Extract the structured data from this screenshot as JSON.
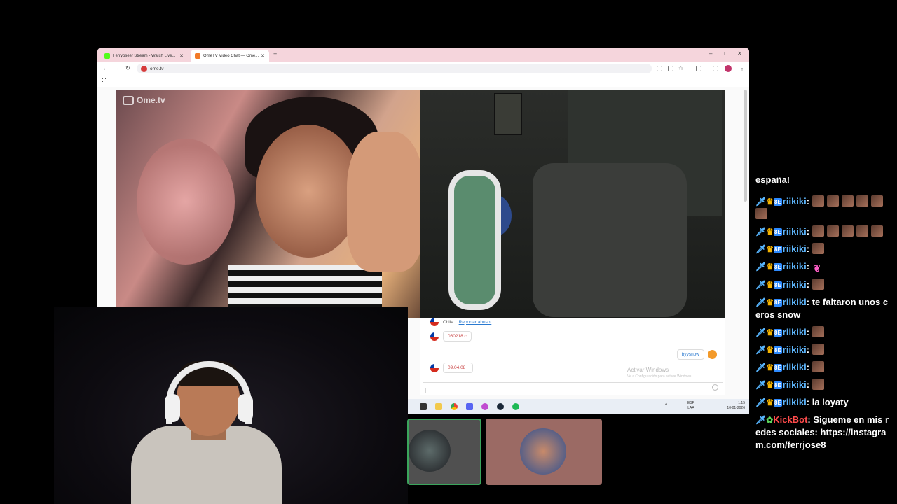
{
  "browser": {
    "tabs": [
      {
        "label": "Ferryoseef Stream - Watch Live...",
        "favicon_color": "#53fc18"
      },
      {
        "label": "OmeTV Video Chat — Ome...",
        "favicon_color": "#f27a28"
      }
    ],
    "new_tab": "+",
    "url": "ome.tv"
  },
  "ometv": {
    "logo": "Ome.tv",
    "chat": {
      "lines": [
        {
          "country": "Chile.",
          "report_label": "Reportar abuso."
        },
        {
          "text": "060218.c"
        },
        {
          "text": "09.04.08_"
        }
      ],
      "own_message": "byysnow",
      "watermark_title": "Activar Windows",
      "watermark_sub": "Ve a Configuración para activar Windows.",
      "input_value": "|"
    }
  },
  "taskbar": {
    "lang": "ESP",
    "lang_sub": "LAA",
    "time": "1:15",
    "date": "10-01-2026"
  },
  "stream_chat": {
    "partial_top": "españa!",
    "messages": [
      {
        "user": "riikiki",
        "text": "",
        "emotes": 6,
        "type": "sub"
      },
      {
        "user": "riikiki",
        "text": "",
        "emotes": 5,
        "type": "sub"
      },
      {
        "user": "riikiki",
        "text": "",
        "emotes": 1,
        "type": "sub"
      },
      {
        "user": "riikiki",
        "text": "",
        "emotes": 1,
        "type": "sub",
        "pink": true
      },
      {
        "user": "riikiki",
        "text": "",
        "emotes": 1,
        "type": "sub"
      },
      {
        "user": "riikiki",
        "text": "te faltaron unos ceros snow",
        "emotes": 0,
        "type": "sub"
      },
      {
        "user": "riikiki",
        "text": "",
        "emotes": 1,
        "type": "sub"
      },
      {
        "user": "riikiki",
        "text": "",
        "emotes": 1,
        "type": "sub"
      },
      {
        "user": "riikiki",
        "text": "",
        "emotes": 1,
        "type": "sub"
      },
      {
        "user": "riikiki",
        "text": "",
        "emotes": 1,
        "type": "sub"
      },
      {
        "user": "riikiki",
        "text": "la loyaty",
        "emotes": 0,
        "type": "sub"
      },
      {
        "user": "KickBot",
        "text": "Sigueme en mis redes sociales: https://instagram.com/ferrjose8",
        "emotes": 0,
        "type": "bot"
      }
    ],
    "badge_tag": "8E",
    "colors": {
      "user": "#5fb8ff",
      "bot": "#ff4b4b"
    }
  }
}
